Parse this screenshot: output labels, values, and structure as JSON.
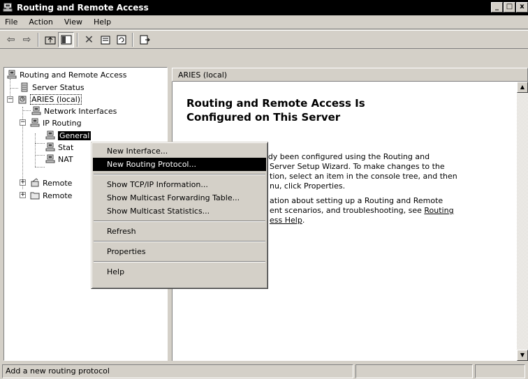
{
  "window": {
    "title": "Routing and Remote Access",
    "controls": [
      "_",
      "□",
      "x"
    ]
  },
  "menubar": {
    "items": [
      "File",
      "Action",
      "View",
      "Help"
    ]
  },
  "toolbar": {
    "buttons": [
      "back-icon",
      "forward-icon",
      "up-folder-icon",
      "show-hide-tree-icon",
      "delete-icon",
      "properties-icon",
      "refresh-icon",
      "export-list-icon"
    ]
  },
  "tree": {
    "root": "Routing and Remote Access",
    "server_status": "Server Status",
    "server": "ARIES (local)",
    "network_interfaces": "Network Interfaces",
    "ip_routing": "IP Routing",
    "general": "General",
    "static_routes": "Stat",
    "nat": "NAT",
    "remote1": "Remote",
    "remote2": "Remote"
  },
  "right": {
    "header": "ARIES (local)",
    "heading_line1": "Routing and Remote Access Is",
    "heading_line2": "Configured on This Server",
    "para1_line1": "This server has already been configured using the Routing and",
    "para1_line2": "Server Setup Wizard. To make changes to the",
    "para1_line3": "tion, select an item in the console tree, and then",
    "para1_line4": "nu, click Properties.",
    "para2_line1": "ation about setting up a Routing and Remote",
    "para2_line2": "ent scenarios, and troubleshooting, see",
    "para2_link1": "Routing",
    "para2_link2": "ess Help",
    "para2_end": "."
  },
  "context_menu": {
    "items": [
      "New Interface...",
      "New Routing Protocol...",
      "Show TCP/IP Information...",
      "Show Multicast Forwarding Table...",
      "Show Multicast Statistics...",
      "Refresh",
      "Properties",
      "Help"
    ],
    "highlighted": "New Routing Protocol..."
  },
  "statusbar": {
    "text": "Add a new routing protocol"
  }
}
